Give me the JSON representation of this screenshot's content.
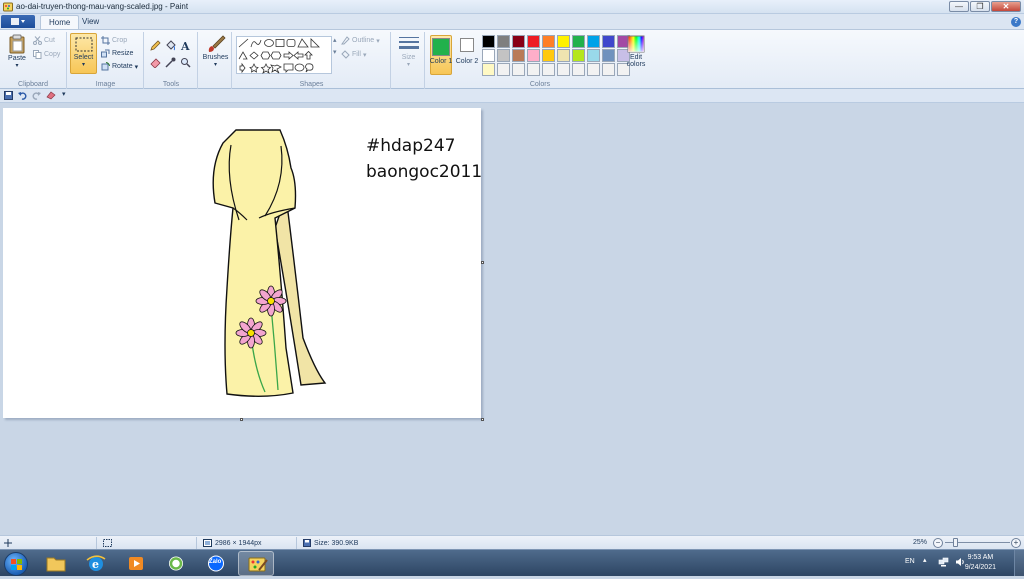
{
  "window": {
    "title": "ao-dai-truyen-thong-mau-vang-scaled.jpg - Paint",
    "min": "—",
    "max": "❐",
    "close": "✕"
  },
  "tabs": {
    "home": "Home",
    "view": "View"
  },
  "help": "?",
  "ribbon": {
    "clipboard": {
      "label": "Clipboard",
      "paste": "Paste",
      "cut": "Cut",
      "copy": "Copy"
    },
    "image": {
      "label": "Image",
      "select": "Select",
      "crop": "Crop",
      "resize": "Resize",
      "rotate": "Rotate"
    },
    "tools": {
      "label": "Tools"
    },
    "brushes": "Brushes",
    "shapes": {
      "label": "Shapes",
      "outline": "Outline",
      "fill": "Fill"
    },
    "size": "Size",
    "colors": {
      "label": "Colors",
      "color1": "Color 1",
      "color2": "Color 2",
      "edit": "Edit colors",
      "color1_value": "#22b14c",
      "color2_value": "#ffffff",
      "palette": [
        "#000000",
        "#7f7f7f",
        "#880015",
        "#ed1c24",
        "#ff7f27",
        "#fff200",
        "#22b14c",
        "#00a2e8",
        "#3f48cc",
        "#a349a4",
        "#ffffff",
        "#c3c3c3",
        "#b97a57",
        "#ffaec9",
        "#ffc90e",
        "#efe4b0",
        "#b5e61d",
        "#99d9ea",
        "#7092be",
        "#c8bfe7",
        "#fff9c4",
        "#f2f2f2",
        "#f2f2f2",
        "#f2f2f2",
        "#f2f2f2",
        "#f2f2f2",
        "#f2f2f2",
        "#f2f2f2",
        "#f2f2f2",
        "#f2f2f2"
      ]
    }
  },
  "canvas": {
    "text_line1": "#hdap247",
    "text_line2": "baongoc2011"
  },
  "status": {
    "dimensions": "2986 × 1944px",
    "size": "Size: 390.9KB",
    "zoom": "25%"
  },
  "taskbar": {
    "lang": "EN",
    "time": "9:53 AM",
    "date": "9/24/2021",
    "zalo": "Zalo"
  }
}
